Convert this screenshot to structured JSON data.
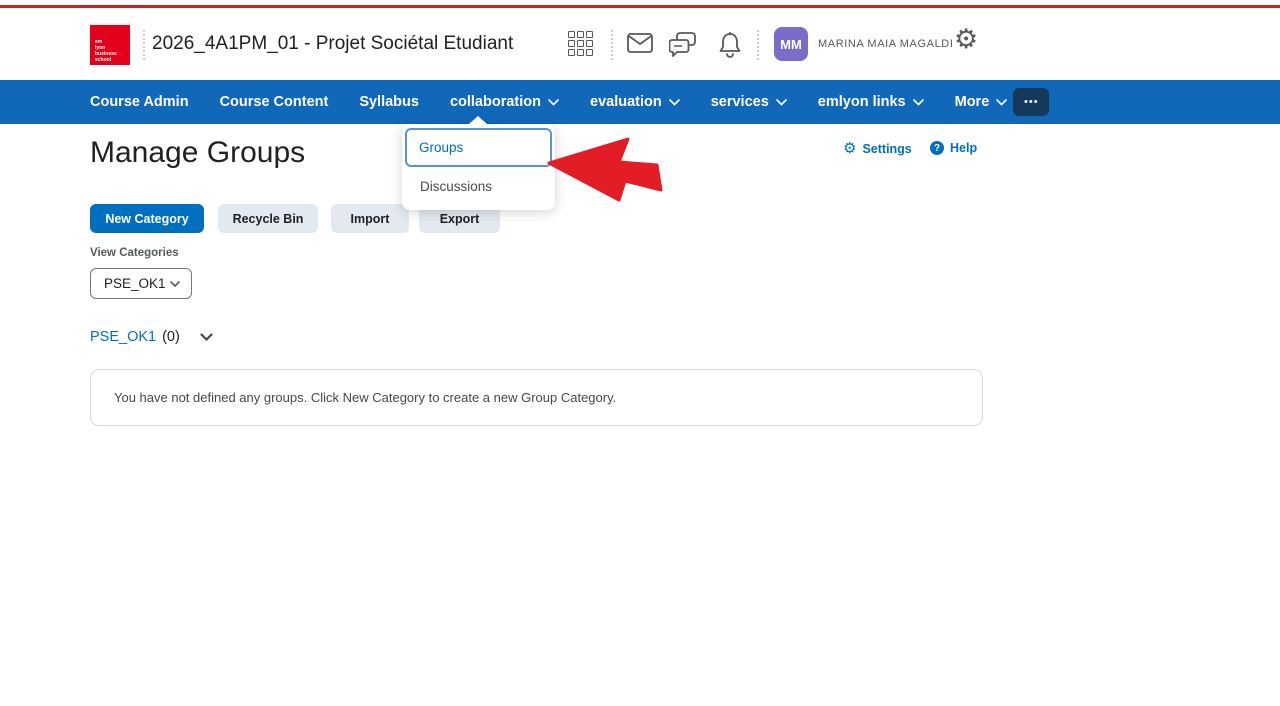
{
  "colors": {
    "top_line_red": "#cb2026",
    "navbar_blue": "#1168b8",
    "accent_blue": "#006fbf",
    "logo_red": "#e2001a",
    "avatar_purple": "#7a6dca",
    "annotation_arrow_red": "#e21d25",
    "secondary_button_gray": "#e3e9f1"
  },
  "header": {
    "logo_text": "em\nlyon\nbusiness\nschool",
    "course_title": "2026_4A1PM_01 - Projet Sociétal Etudiant",
    "icons": [
      "waffle-grid-icon",
      "mail-icon",
      "chat-icon",
      "bell-icon",
      "gear-icon"
    ],
    "user": {
      "initials": "MM",
      "name": "MARINA MAIA MAGALDI"
    }
  },
  "navbar": {
    "items": [
      {
        "label": "Course Admin",
        "has_dropdown": false
      },
      {
        "label": "Course Content",
        "has_dropdown": false
      },
      {
        "label": "Syllabus",
        "has_dropdown": false
      },
      {
        "label": "collaboration",
        "has_dropdown": true
      },
      {
        "label": "evaluation",
        "has_dropdown": true
      },
      {
        "label": "services",
        "has_dropdown": true
      },
      {
        "label": "emlyon links",
        "has_dropdown": true
      },
      {
        "label": "More",
        "has_dropdown": true
      }
    ],
    "overflow_label": "•••"
  },
  "collaboration_menu": {
    "items": [
      {
        "label": "Groups",
        "focused": true
      },
      {
        "label": "Discussions",
        "focused": false
      }
    ]
  },
  "page": {
    "title": "Manage Groups",
    "settings_label": "Settings",
    "help_label": "Help",
    "action_buttons": [
      {
        "label": "New Category",
        "style": "primary"
      },
      {
        "label": "Recycle Bin",
        "style": "secondary"
      },
      {
        "label": "Import",
        "style": "secondary"
      },
      {
        "label": "Export",
        "style": "secondary"
      }
    ],
    "view_categories_label": "View Categories",
    "category_select_value": "PSE_OK1",
    "category_heading": {
      "name": "PSE_OK1",
      "count": "(0)"
    },
    "empty_message": "You have not defined any groups. Click New Category to create a new Group Category."
  }
}
